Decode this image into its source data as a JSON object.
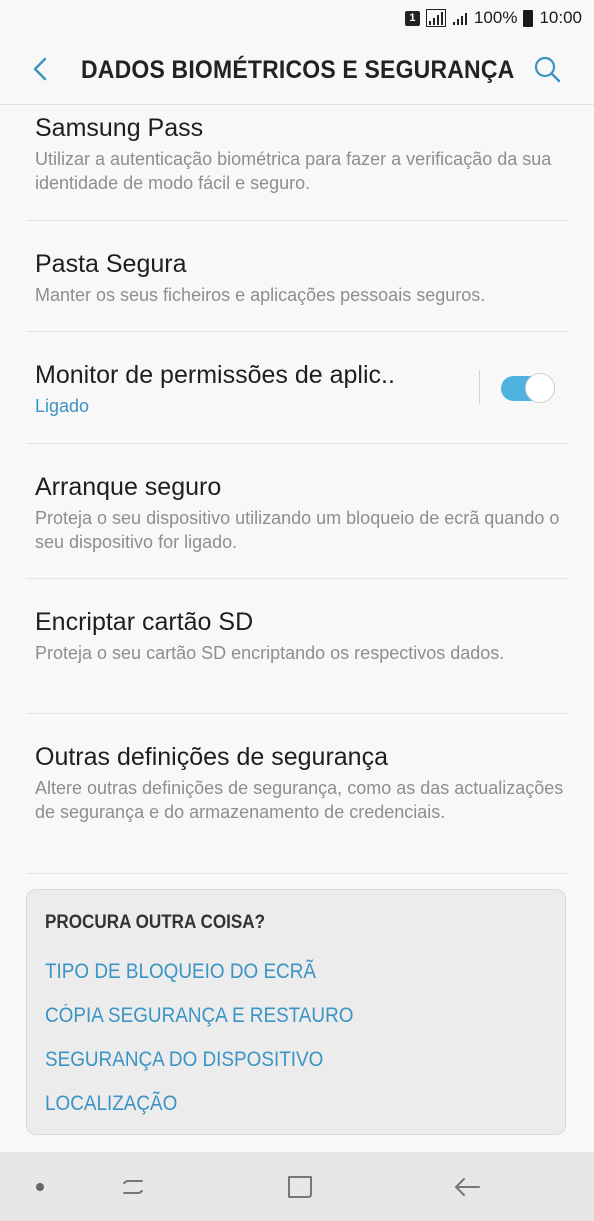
{
  "status_bar": {
    "sim_label": "1",
    "battery_percent": "100%",
    "time": "10:00"
  },
  "header": {
    "title": "DADOS BIOMÉTRICOS E SEGURANÇA",
    "back_icon": "back-arrow-icon",
    "search_icon": "search-icon"
  },
  "items": [
    {
      "title": "Samsung Pass",
      "subtitle": "Utilizar a autenticação biométrica para fazer a verificação da sua identidade de modo fácil e seguro."
    },
    {
      "title": "Pasta Segura",
      "subtitle": "Manter os seus ficheiros e aplicações pessoais seguros."
    },
    {
      "title": "Monitor de permissões de aplic..",
      "subtitle": "Ligado",
      "toggle_on": true
    },
    {
      "title": "Arranque seguro",
      "subtitle": "Proteja o seu dispositivo utilizando um bloqueio de ecrã quando o seu dispositivo for ligado."
    },
    {
      "title": "Encriptar cartão SD",
      "subtitle": "Proteja o seu cartão SD encriptando os respectivos dados."
    },
    {
      "title": "Outras definições de segurança",
      "subtitle": "Altere outras definições de segurança, como as das actualizações de segurança e do armazenamento de credenciais."
    }
  ],
  "suggestions": {
    "heading": "PROCURA OUTRA COISA?",
    "links": [
      "TIPO DE BLOQUEIO DO ECRÃ",
      "CÓPIA SEGURANÇA E RESTAURO",
      "SEGURANÇA DO DISPOSITIVO",
      "LOCALIZAÇÃO"
    ]
  },
  "colors": {
    "accent": "#3a94c4",
    "toggle": "#4fb3e0"
  }
}
